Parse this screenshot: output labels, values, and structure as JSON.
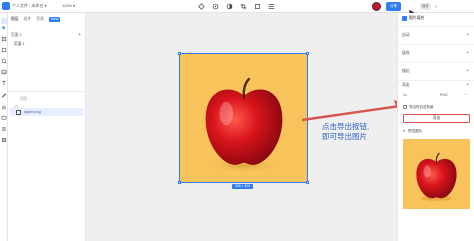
{
  "topbar": {
    "breadcrumb": "个人文件 / 未命名 ▾",
    "zoom": "113% ▾",
    "share_label": "分享",
    "seg_design": "设计",
    "seg_prototype": "?",
    "tools": [
      "component-icon",
      "pen-icon",
      "contrast-icon",
      "crop-icon",
      "frame-icon",
      "align-icon"
    ]
  },
  "layers_panel": {
    "tabs": [
      "图层",
      "组件",
      "资源"
    ],
    "badge": "New",
    "pages_title": "页面 1",
    "page_item": "页面 1",
    "search_placeholder": "搜索",
    "layer_name": "apple.png"
  },
  "canvas": {
    "size_badge": "308 × 308",
    "callout_line1": "点击导出按钮,",
    "callout_line2": "即可导出图片"
  },
  "right_panel": {
    "selection": "图片填充",
    "sec_layout": "自动",
    "sec_fill": "填充",
    "sec_stroke": "描边",
    "sec_export": "导出",
    "scale": "1x",
    "format": "PNG",
    "checkbox_label": "导出时包含背景",
    "export_label": "导出",
    "preview_title": "预览图片"
  },
  "colors": {
    "accent": "#2e7cf6",
    "highlight_red": "#d9534f",
    "callout_blue": "#2f5fc9",
    "image_bg": "#f8c35a"
  }
}
